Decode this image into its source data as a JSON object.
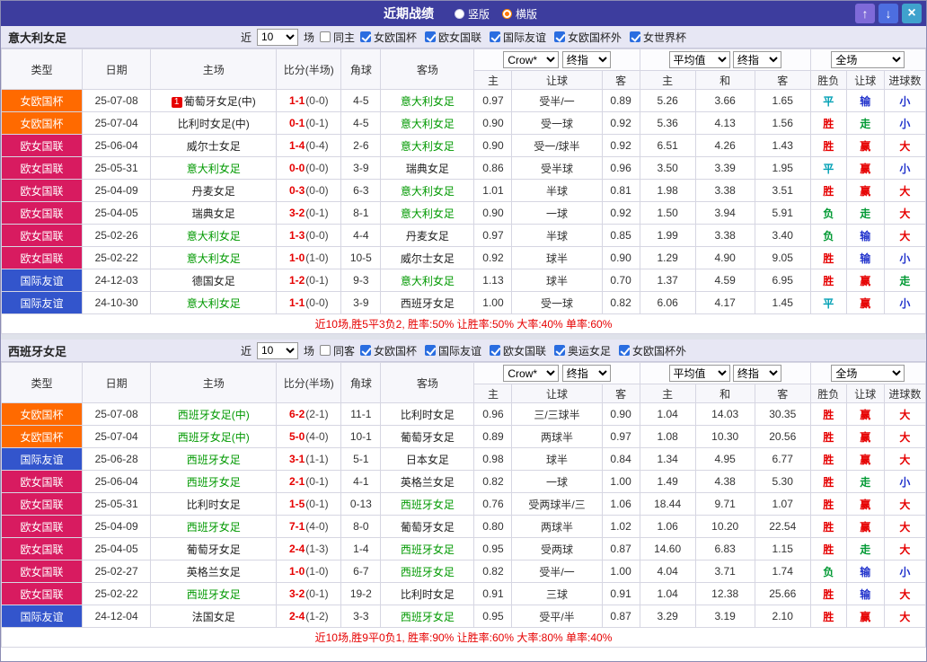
{
  "titlebar": {
    "title": "近期战绩",
    "radios": [
      {
        "label": "竖版",
        "checked": false
      },
      {
        "label": "横版",
        "checked": true
      }
    ],
    "up_icon": "↑",
    "down_icon": "↓",
    "close_icon": "×"
  },
  "type_colors": {
    "女欧国杯": "#ff6a00",
    "欧女国联": "#d81b60",
    "国际友谊": "#3355cc"
  },
  "result_colors": {
    "胜": "#e60000",
    "平": "#00a0b4",
    "负": "#009933",
    "赢": "#e60000",
    "输": "#2233cc",
    "走": "#009933",
    "大": "#e60000",
    "小": "#2233cc"
  },
  "table_header": {
    "cols": [
      "类型",
      "日期",
      "主场",
      "比分(半场)",
      "角球",
      "客场"
    ],
    "odds_group_selects": [
      "Crow*",
      "终指"
    ],
    "odds_cols": [
      "主",
      "让球",
      "客"
    ],
    "avg_group_selects": [
      "平均值",
      "终指"
    ],
    "avg_cols": [
      "主",
      "和",
      "客"
    ],
    "full_select": "全场",
    "result_cols": [
      "胜负",
      "让球",
      "进球数"
    ]
  },
  "sections": [
    {
      "team": "意大利女足",
      "filter": {
        "near_label": "近",
        "count": "10",
        "unit_label": "场",
        "same": {
          "label": "同主",
          "checked": false
        },
        "leagues": [
          "女欧国杯",
          "欧女国联",
          "国际友谊",
          "女欧国杯外",
          "女世界杯"
        ]
      },
      "rows": [
        {
          "type": "女欧国杯",
          "date": "25-07-08",
          "badge": "1",
          "home": "葡萄牙女足(中)",
          "score": "1-1",
          "half": "(0-0)",
          "corner": "4-5",
          "away": "意大利女足",
          "o1": "0.97",
          "hcap": "受半/一",
          "o2": "0.89",
          "a1": "5.26",
          "a2": "3.66",
          "a3": "1.65",
          "r1": "平",
          "r2": "输",
          "r3": "小"
        },
        {
          "type": "女欧国杯",
          "date": "25-07-04",
          "home": "比利时女足(中)",
          "score": "0-1",
          "half": "(0-1)",
          "corner": "4-5",
          "away": "意大利女足",
          "o1": "0.90",
          "hcap": "受一球",
          "o2": "0.92",
          "a1": "5.36",
          "a2": "4.13",
          "a3": "1.56",
          "r1": "胜",
          "r2": "走",
          "r3": "小"
        },
        {
          "type": "欧女国联",
          "date": "25-06-04",
          "home": "威尔士女足",
          "score": "1-4",
          "half": "(0-4)",
          "corner": "2-6",
          "away": "意大利女足",
          "o1": "0.90",
          "hcap": "受一/球半",
          "o2": "0.92",
          "a1": "6.51",
          "a2": "4.26",
          "a3": "1.43",
          "r1": "胜",
          "r2": "赢",
          "r3": "大"
        },
        {
          "type": "欧女国联",
          "date": "25-05-31",
          "home": "意大利女足",
          "score": "0-0",
          "half": "(0-0)",
          "corner": "3-9",
          "away": "瑞典女足",
          "o1": "0.86",
          "hcap": "受半球",
          "o2": "0.96",
          "a1": "3.50",
          "a2": "3.39",
          "a3": "1.95",
          "r1": "平",
          "r2": "赢",
          "r3": "小"
        },
        {
          "type": "欧女国联",
          "date": "25-04-09",
          "home": "丹麦女足",
          "score": "0-3",
          "half": "(0-0)",
          "corner": "6-3",
          "away": "意大利女足",
          "o1": "1.01",
          "hcap": "半球",
          "o2": "0.81",
          "a1": "1.98",
          "a2": "3.38",
          "a3": "3.51",
          "r1": "胜",
          "r2": "赢",
          "r3": "大"
        },
        {
          "type": "欧女国联",
          "date": "25-04-05",
          "home": "瑞典女足",
          "score": "3-2",
          "half": "(0-1)",
          "corner": "8-1",
          "away": "意大利女足",
          "o1": "0.90",
          "hcap": "一球",
          "o2": "0.92",
          "a1": "1.50",
          "a2": "3.94",
          "a3": "5.91",
          "r1": "负",
          "r2": "走",
          "r3": "大"
        },
        {
          "type": "欧女国联",
          "date": "25-02-26",
          "home": "意大利女足",
          "score": "1-3",
          "half": "(0-0)",
          "corner": "4-4",
          "away": "丹麦女足",
          "o1": "0.97",
          "hcap": "半球",
          "o2": "0.85",
          "a1": "1.99",
          "a2": "3.38",
          "a3": "3.40",
          "r1": "负",
          "r2": "输",
          "r3": "大"
        },
        {
          "type": "欧女国联",
          "date": "25-02-22",
          "home": "意大利女足",
          "score": "1-0",
          "half": "(1-0)",
          "corner": "10-5",
          "away": "威尔士女足",
          "o1": "0.92",
          "hcap": "球半",
          "o2": "0.90",
          "a1": "1.29",
          "a2": "4.90",
          "a3": "9.05",
          "r1": "胜",
          "r2": "输",
          "r3": "小"
        },
        {
          "type": "国际友谊",
          "date": "24-12-03",
          "home": "德国女足",
          "score": "1-2",
          "half": "(0-1)",
          "corner": "9-3",
          "away": "意大利女足",
          "o1": "1.13",
          "hcap": "球半",
          "o2": "0.70",
          "a1": "1.37",
          "a2": "4.59",
          "a3": "6.95",
          "r1": "胜",
          "r2": "赢",
          "r3": "走"
        },
        {
          "type": "国际友谊",
          "date": "24-10-30",
          "home": "意大利女足",
          "score": "1-1",
          "half": "(0-0)",
          "corner": "3-9",
          "away": "西班牙女足",
          "o1": "1.00",
          "hcap": "受一球",
          "o2": "0.82",
          "a1": "6.06",
          "a2": "4.17",
          "a3": "1.45",
          "r1": "平",
          "r2": "赢",
          "r3": "小"
        }
      ],
      "summary": "近10场,胜5平3负2, 胜率:50% 让胜率:50% 大率:40% 单率:60%"
    },
    {
      "team": "西班牙女足",
      "filter": {
        "near_label": "近",
        "count": "10",
        "unit_label": "场",
        "same": {
          "label": "同客",
          "checked": false
        },
        "leagues": [
          "女欧国杯",
          "国际友谊",
          "欧女国联",
          "奥运女足",
          "女欧国杯外"
        ]
      },
      "rows": [
        {
          "type": "女欧国杯",
          "date": "25-07-08",
          "home": "西班牙女足(中)",
          "score": "6-2",
          "half": "(2-1)",
          "corner": "11-1",
          "away": "比利时女足",
          "o1": "0.96",
          "hcap": "三/三球半",
          "o2": "0.90",
          "a1": "1.04",
          "a2": "14.03",
          "a3": "30.35",
          "r1": "胜",
          "r2": "赢",
          "r3": "大"
        },
        {
          "type": "女欧国杯",
          "date": "25-07-04",
          "home": "西班牙女足(中)",
          "score": "5-0",
          "half": "(4-0)",
          "corner": "10-1",
          "away": "葡萄牙女足",
          "o1": "0.89",
          "hcap": "两球半",
          "o2": "0.97",
          "a1": "1.08",
          "a2": "10.30",
          "a3": "20.56",
          "r1": "胜",
          "r2": "赢",
          "r3": "大"
        },
        {
          "type": "国际友谊",
          "date": "25-06-28",
          "home": "西班牙女足",
          "score": "3-1",
          "half": "(1-1)",
          "corner": "5-1",
          "away": "日本女足",
          "o1": "0.98",
          "hcap": "球半",
          "o2": "0.84",
          "a1": "1.34",
          "a2": "4.95",
          "a3": "6.77",
          "r1": "胜",
          "r2": "赢",
          "r3": "大"
        },
        {
          "type": "欧女国联",
          "date": "25-06-04",
          "home": "西班牙女足",
          "score": "2-1",
          "half": "(0-1)",
          "corner": "4-1",
          "away": "英格兰女足",
          "o1": "0.82",
          "hcap": "一球",
          "o2": "1.00",
          "a1": "1.49",
          "a2": "4.38",
          "a3": "5.30",
          "r1": "胜",
          "r2": "走",
          "r3": "小"
        },
        {
          "type": "欧女国联",
          "date": "25-05-31",
          "home": "比利时女足",
          "score": "1-5",
          "half": "(0-1)",
          "corner": "0-13",
          "away": "西班牙女足",
          "o1": "0.76",
          "hcap": "受两球半/三",
          "o2": "1.06",
          "a1": "18.44",
          "a2": "9.71",
          "a3": "1.07",
          "r1": "胜",
          "r2": "赢",
          "r3": "大"
        },
        {
          "type": "欧女国联",
          "date": "25-04-09",
          "home": "西班牙女足",
          "score": "7-1",
          "half": "(4-0)",
          "corner": "8-0",
          "away": "葡萄牙女足",
          "o1": "0.80",
          "hcap": "两球半",
          "o2": "1.02",
          "a1": "1.06",
          "a2": "10.20",
          "a3": "22.54",
          "r1": "胜",
          "r2": "赢",
          "r3": "大"
        },
        {
          "type": "欧女国联",
          "date": "25-04-05",
          "home": "葡萄牙女足",
          "score": "2-4",
          "half": "(1-3)",
          "corner": "1-4",
          "away": "西班牙女足",
          "o1": "0.95",
          "hcap": "受两球",
          "o2": "0.87",
          "a1": "14.60",
          "a2": "6.83",
          "a3": "1.15",
          "r1": "胜",
          "r2": "走",
          "r3": "大"
        },
        {
          "type": "欧女国联",
          "date": "25-02-27",
          "home": "英格兰女足",
          "score": "1-0",
          "half": "(1-0)",
          "corner": "6-7",
          "away": "西班牙女足",
          "o1": "0.82",
          "hcap": "受半/一",
          "o2": "1.00",
          "a1": "4.04",
          "a2": "3.71",
          "a3": "1.74",
          "r1": "负",
          "r2": "输",
          "r3": "小"
        },
        {
          "type": "欧女国联",
          "date": "25-02-22",
          "home": "西班牙女足",
          "score": "3-2",
          "half": "(0-1)",
          "corner": "19-2",
          "away": "比利时女足",
          "o1": "0.91",
          "hcap": "三球",
          "o2": "0.91",
          "a1": "1.04",
          "a2": "12.38",
          "a3": "25.66",
          "r1": "胜",
          "r2": "输",
          "r3": "大"
        },
        {
          "type": "国际友谊",
          "date": "24-12-04",
          "home": "法国女足",
          "score": "2-4",
          "half": "(1-2)",
          "corner": "3-3",
          "away": "西班牙女足",
          "o1": "0.95",
          "hcap": "受平/半",
          "o2": "0.87",
          "a1": "3.29",
          "a2": "3.19",
          "a3": "2.10",
          "r1": "胜",
          "r2": "赢",
          "r3": "大"
        }
      ],
      "summary": "近10场,胜9平0负1, 胜率:90% 让胜率:60% 大率:80% 单率:40%"
    }
  ]
}
